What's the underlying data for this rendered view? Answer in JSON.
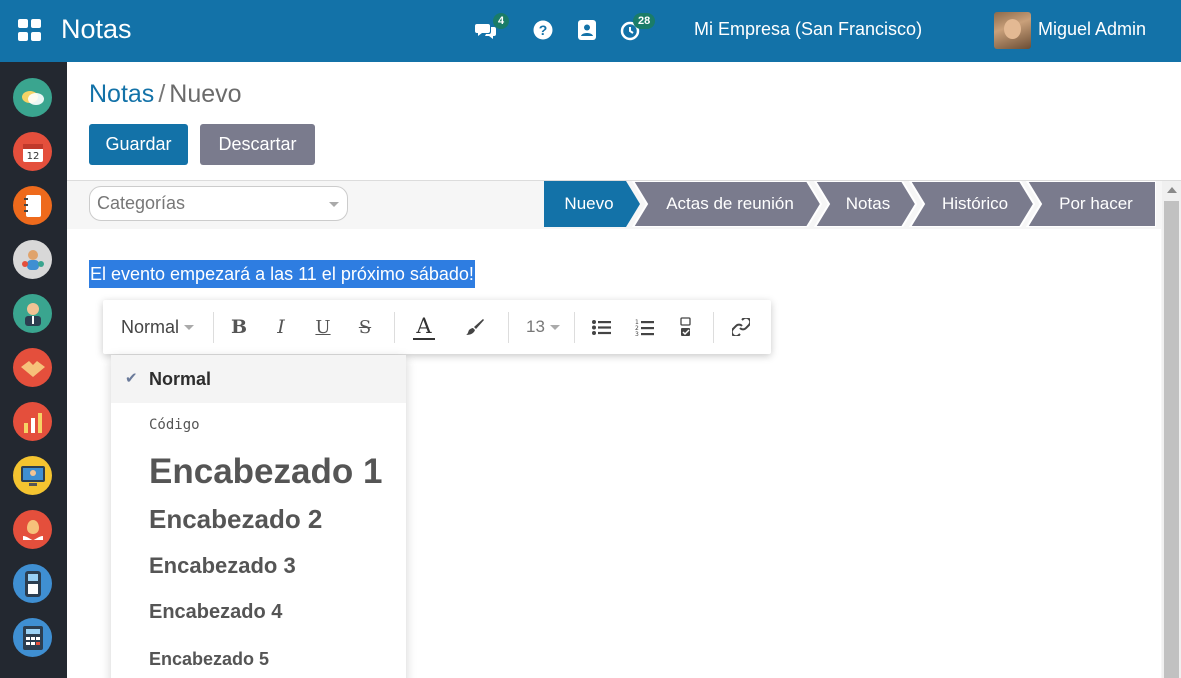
{
  "header": {
    "app_title": "Notas",
    "company": "Mi Empresa (San Francisco)",
    "user_name": "Miguel Admin",
    "messages_badge": "4",
    "activity_badge": "28"
  },
  "sidebar": {
    "apps": [
      {
        "icon": "discuss-icon",
        "color": "#3aa58f"
      },
      {
        "icon": "calendar-icon",
        "color": "#e44f3c",
        "text": "12"
      },
      {
        "icon": "notes-icon",
        "color": "#ee6a1c"
      },
      {
        "icon": "contacts-icon",
        "color": "#d8d8d8"
      },
      {
        "icon": "employees-icon",
        "color": "#3aa58f"
      },
      {
        "icon": "crm-icon",
        "color": "#e44f3c"
      },
      {
        "icon": "sales-icon",
        "color": "#e44f3c"
      },
      {
        "icon": "dashboard-icon",
        "color": "#f4c430"
      },
      {
        "icon": "expenses-icon",
        "color": "#e44f3c"
      },
      {
        "icon": "pos-icon",
        "color": "#3f8fd2"
      },
      {
        "icon": "invoicing-icon",
        "color": "#3f8fd2"
      }
    ]
  },
  "breadcrumb": {
    "parent": "Notas",
    "separator": "/",
    "current": "Nuevo"
  },
  "actions": {
    "save_label": "Guardar",
    "discard_label": "Descartar"
  },
  "form": {
    "categories_placeholder": "Categorías",
    "stages": [
      "Nuevo",
      "Actas de reunión",
      "Notas",
      "Histórico",
      "Por hacer"
    ],
    "active_stage": "Nuevo",
    "selected_text": "El evento empezará a las 11 el próximo sábado!"
  },
  "toolbar": {
    "style_value": "Normal",
    "bold_label": "B",
    "italic_label": "I",
    "underline_label": "U",
    "strike_label": "S",
    "font_color_label": "A",
    "font_size_value": "13"
  },
  "style_dropdown": {
    "items": [
      "Normal",
      "Código",
      "Encabezado 1",
      "Encabezado 2",
      "Encabezado 3",
      "Encabezado 4",
      "Encabezado 5"
    ],
    "selected": "Normal",
    "check_glyph": "✔"
  },
  "colors": {
    "brand": "#1372a8",
    "stage_inactive": "#7a7b8d",
    "selection": "#2e7de1",
    "sidebar": "#232830"
  }
}
